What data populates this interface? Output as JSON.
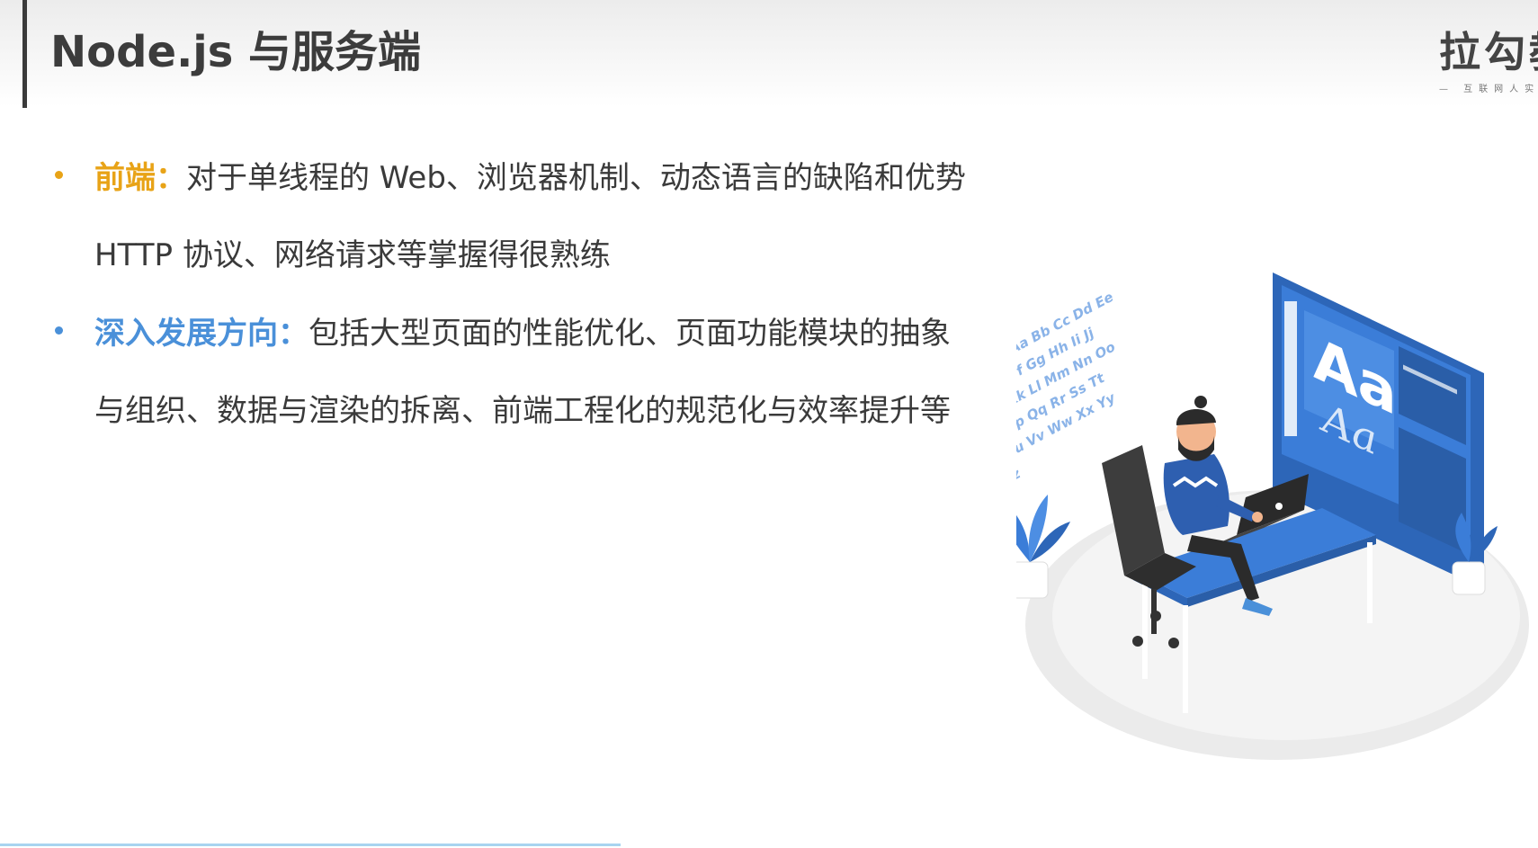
{
  "title": "Node.js 与服务端",
  "logo": {
    "main": "拉勾教",
    "sub": "— 互联网人实"
  },
  "bullets": [
    {
      "keyword": "前端：",
      "lines": [
        "对于单线程的 Web、浏览器机制、动态语言的缺陷和优势",
        "HTTP 协议、网络请求等掌握得很熟练"
      ]
    },
    {
      "keyword": "深入发展方向：",
      "lines": [
        "包括大型页面的性能优化、页面功能模块的抽象",
        "与组织、数据与渲染的拆离、前端工程化的规范化与效率提升等"
      ]
    }
  ],
  "illustration": {
    "big_letters": "Aa",
    "script_letters": "Aa",
    "alphabet_pairs": [
      "Aa",
      "Bb",
      "Cc",
      "Dd",
      "Ee",
      "Ff",
      "Gg",
      "Hh",
      "Ii",
      "Jj",
      "Kk",
      "Ll",
      "Mm",
      "Nn",
      "Oo",
      "Pp",
      "Qq",
      "Rr",
      "Ss",
      "Tt",
      "Uu",
      "Vv",
      "Ww",
      "Xx",
      "Yy",
      "Zz"
    ]
  },
  "colors": {
    "accent_orange": "#e8a317",
    "accent_blue": "#4a90d9",
    "illustration_blue": "#3b7dd8"
  }
}
